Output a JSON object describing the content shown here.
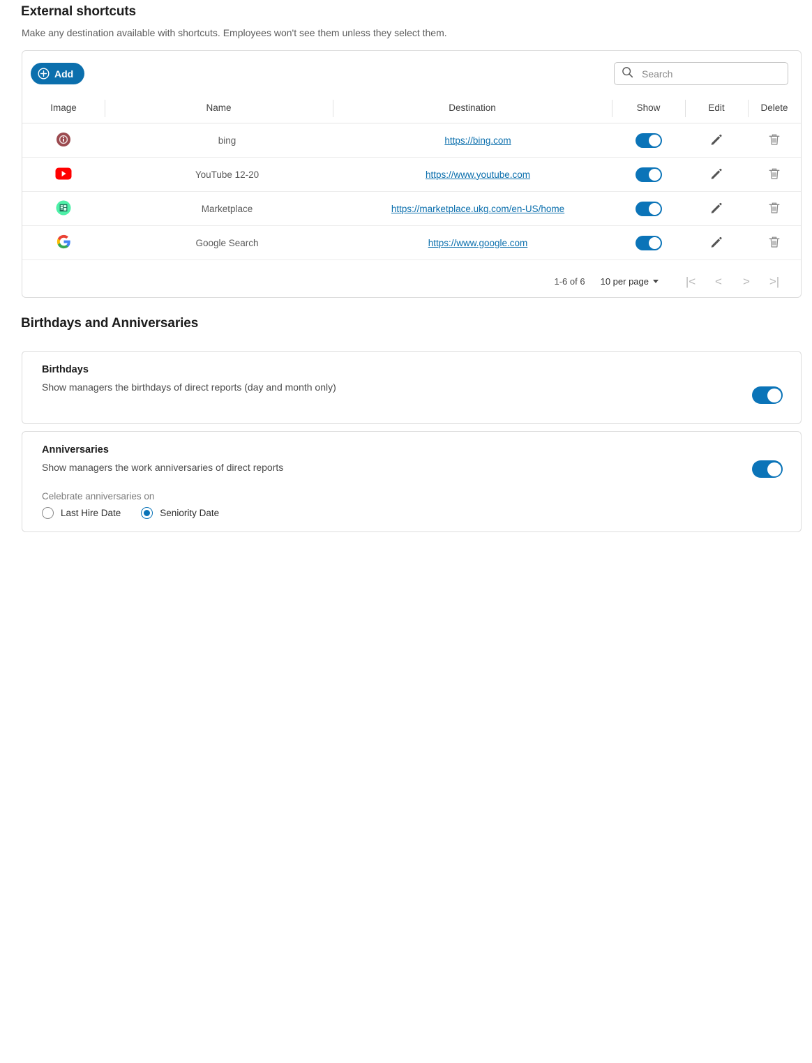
{
  "sections": {
    "shortcuts": {
      "title": "External shortcuts",
      "description": "Make any destination available with shortcuts. Employees won't see them unless they select them.",
      "add_label": "Add",
      "search_placeholder": "Search",
      "search_value": "",
      "columns": [
        "Image",
        "Name",
        "Destination",
        "Show",
        "Edit",
        "Delete"
      ],
      "rows": [
        {
          "icon": "broken-image-icon",
          "name": "bing",
          "destination": "https://bing.com",
          "show": true
        },
        {
          "icon": "youtube-icon",
          "name": "YouTube 12-20",
          "destination": "https://www.youtube.com",
          "show": true
        },
        {
          "icon": "marketplace-icon",
          "name": "Marketplace",
          "destination": "https://marketplace.ukg.com/en-US/home",
          "show": true
        },
        {
          "icon": "google-icon",
          "name": "Google Search",
          "destination": "https://www.google.com",
          "show": true
        }
      ],
      "pagination": {
        "range": "1-6 of 6",
        "per_page": "10 per page",
        "first_label": "|<",
        "prev_label": "<",
        "next_label": ">",
        "last_label": ">|"
      }
    },
    "birthdays_anniversaries": {
      "title": "Birthdays and Anniversaries",
      "birthdays": {
        "title": "Birthdays",
        "description": "Show managers the birthdays of direct reports (day and month only)",
        "enabled": true
      },
      "anniversaries": {
        "title": "Anniversaries",
        "description": "Show managers the work anniversaries of direct reports",
        "enabled": true,
        "radio_group_label": "Celebrate anniversaries on",
        "options": [
          {
            "label": "Last Hire Date",
            "selected": false
          },
          {
            "label": "Seniority Date",
            "selected": true
          }
        ]
      }
    }
  },
  "colors": {
    "accent_blue": "#0b6fad",
    "toggle_blue": "#0b74b8",
    "link_blue": "#0b6fad",
    "text_dark": "#1d1d1d",
    "text_muted": "#5b5b5b",
    "border": "#dcdcdc"
  }
}
